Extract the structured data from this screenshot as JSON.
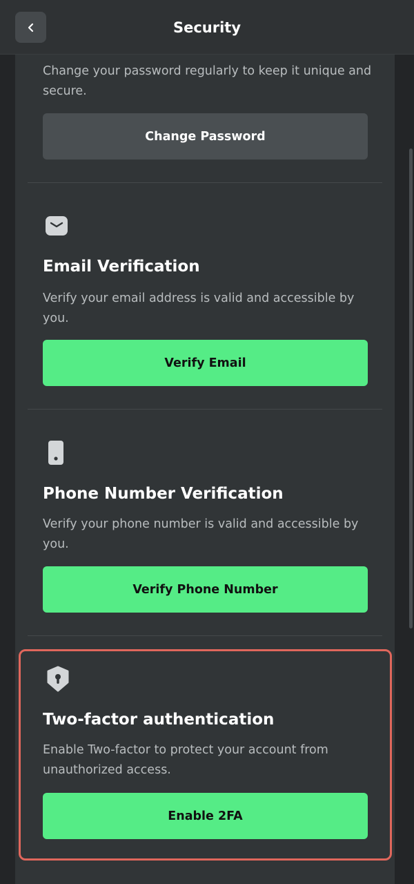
{
  "header": {
    "title": "Security",
    "back_icon": "chevron-left-icon"
  },
  "password": {
    "description": "Change your password regularly to keep it unique and secure.",
    "button_label": "Change Password"
  },
  "email": {
    "icon": "envelope-icon",
    "title": "Email Verification",
    "description": "Verify your email address is valid and accessible by you.",
    "button_label": "Verify Email"
  },
  "phone": {
    "icon": "phone-icon",
    "title": "Phone Number Verification",
    "description": "Verify your phone number is valid and accessible by you.",
    "button_label": "Verify Phone Number"
  },
  "two_factor": {
    "icon": "shield-keyhole-icon",
    "title": "Two-factor authentication",
    "description": "Enable Two-factor to protect your account from unauthorized access.",
    "button_label": "Enable 2FA"
  },
  "colors": {
    "accent_green": "#55ec86",
    "highlight_border": "#e0675c",
    "background": "#2b2e30"
  }
}
